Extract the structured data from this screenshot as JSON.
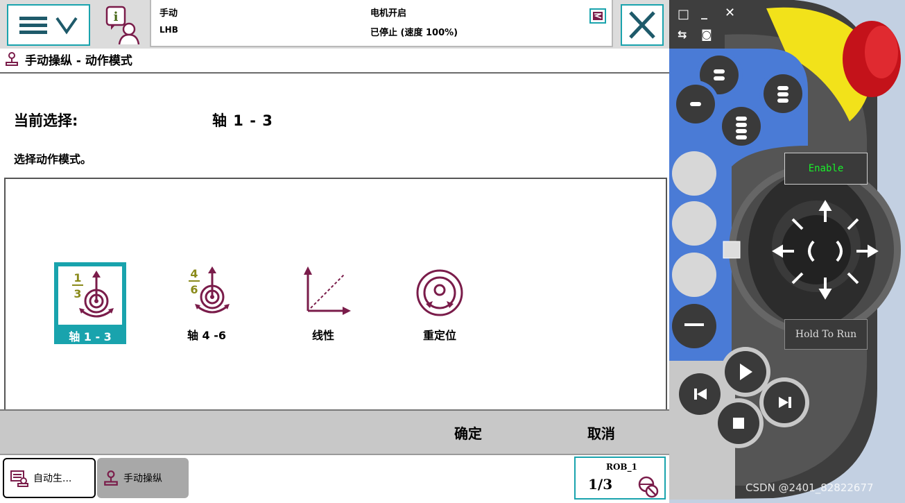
{
  "status": {
    "mode": "手动",
    "system": "LHB",
    "motor": "电机开启",
    "state": "已停止 (速度 100%)"
  },
  "breadcrumb": "手动操纵 - 动作模式",
  "current_selection": {
    "label": "当前选择:",
    "value": "轴 1 - 3"
  },
  "prompt": "选择动作模式。",
  "modes": [
    {
      "label": "轴 1 - 3",
      "selected": true,
      "icon": "axis-1-3-icon",
      "fraction": [
        "1",
        "3"
      ]
    },
    {
      "label": "轴 4 -6",
      "selected": false,
      "icon": "axis-4-6-icon",
      "fraction": [
        "4",
        "6"
      ]
    },
    {
      "label": "线性",
      "selected": false,
      "icon": "linear-icon"
    },
    {
      "label": "重定位",
      "selected": false,
      "icon": "reorient-icon"
    }
  ],
  "actions": {
    "ok": "确定",
    "cancel": "取消"
  },
  "taskbar": {
    "task1": "自动生...",
    "task2": "手动操纵",
    "robot": "ROB_1",
    "increment": "1/3"
  },
  "pendant": {
    "enable": "Enable",
    "hold_to_run": "Hold To Run"
  },
  "watermark": "CSDN @2401_82822677",
  "colors": {
    "accent": "#19a3ad",
    "icon": "#7a1c4a",
    "fraction": "#8a8a1a",
    "pendant_blue": "#4a7bd6"
  }
}
